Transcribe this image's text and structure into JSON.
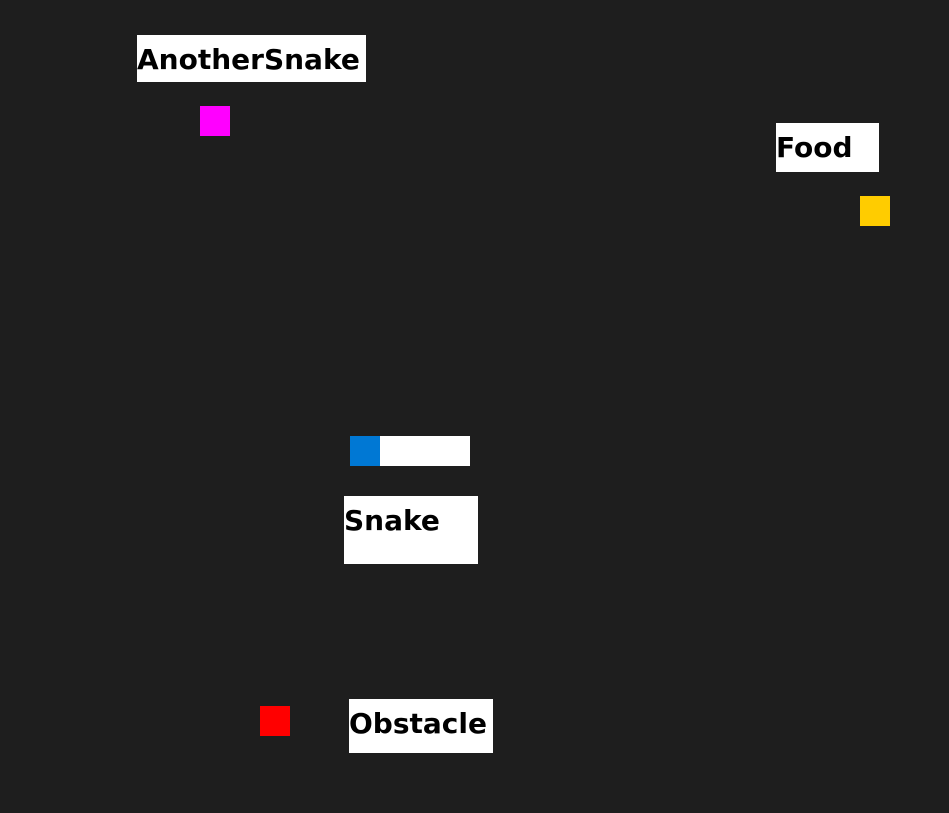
{
  "colors": {
    "background": "#1e1e1e",
    "label_background": "#ffffff",
    "label_text": "#000000",
    "another_snake": "#ff00ff",
    "food": "#ffcc00",
    "snake_head": "#0078d4",
    "snake_body": "#ffffff",
    "obstacle": "#ff0000"
  },
  "entities": {
    "another_snake": {
      "label": "AnotherSnake"
    },
    "food": {
      "label": "Food"
    },
    "snake": {
      "label": "Snake"
    },
    "obstacle": {
      "label": "Obstacle"
    }
  }
}
